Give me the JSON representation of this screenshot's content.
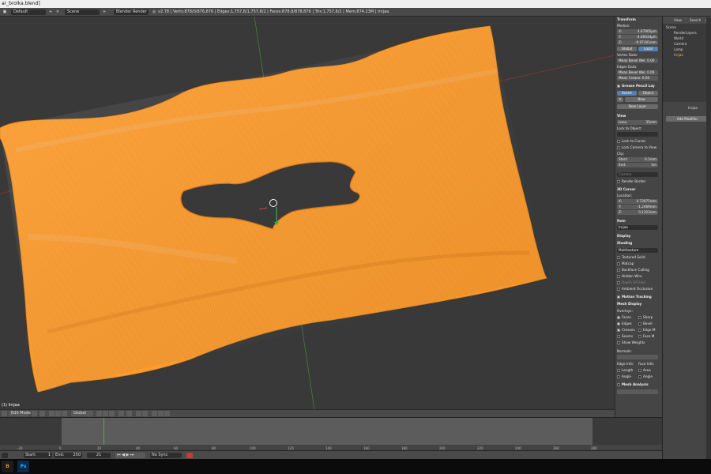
{
  "window": {
    "title": "ar_brolka.blend]"
  },
  "topbar": {
    "layout": "Default",
    "scene": "Scene",
    "render_engine": "Blender Render",
    "stats": "v2.78 | Verts:878/0/876,876 | Edges:1,757,8/1,757,8/2 | Faces:878,8/878,876 | Tris:1,757,8/2 | Mem:874.23M | Irnjaa"
  },
  "viewport": {
    "object_label": "(1) Irnjaa",
    "mesh_color": "#ff9d2e",
    "background": "#393939"
  },
  "viewport_header": {
    "mode": "Edit Mode",
    "pivot": "Global"
  },
  "timeline": {
    "start_label": "Start:",
    "start_value": "1",
    "end_label": "End:",
    "end_value": "250",
    "current_frame": "21",
    "sync": "No Sync",
    "ticks": [
      "-20",
      "0",
      "20",
      "40",
      "60",
      "80",
      "100",
      "120",
      "140",
      "160",
      "180",
      "200",
      "220",
      "240",
      "260",
      "280"
    ]
  },
  "properties": {
    "transform": "Transform",
    "median": "Median:",
    "x_label": "X:",
    "x_value": "4.67905μm",
    "y_label": "Y:",
    "y_value": "-4.60034μm",
    "z_label": "Z:",
    "z_value": "-0.97301mm",
    "global": "Global",
    "local": "Local",
    "vertex_data": "Vertex Data:",
    "mean_bevel_weight": "Mean Bevel Wei: 0.00",
    "edges_data": "Edges Data:",
    "mean_bevel_weight2": "Mean Bevel Wei: 0.00",
    "mean_crease": "Mean Crease: 0.00",
    "grease_pencil": "Grease Pencil Lay",
    "scene": "Scene",
    "object": "Object",
    "new": "New",
    "new_layer": "New Layer",
    "view": "View",
    "lens_label": "Lens:",
    "lens_value": "35mm",
    "lock_to_object": "Lock to Object:",
    "lock_to_cursor": "Lock to Cursor",
    "lock_camera": "Lock Camera to View",
    "clip": "Clip:",
    "clip_start_label": "Start:",
    "clip_start_value": "0.1mm",
    "clip_end_label": "End:",
    "clip_end_value": "1m",
    "local_camera": "Camera",
    "render_border": "Render Border",
    "cursor": "3D Cursor",
    "location": "Location:",
    "cx_label": "X:",
    "cx_value": "4.73075mm",
    "cy_label": "Y:",
    "cy_value": "-1.2469mm",
    "cz_label": "Z:",
    "cz_value": "0.1323mm",
    "item": "Item",
    "item_name": "Irnjaa",
    "display": "Display",
    "shading": "Shading",
    "shading_mode": "Multitexture",
    "textured_solid": "Textured Solid",
    "matcap": "Matcap",
    "backface": "Backface Culling",
    "hidden_wire": "Hidden Wire",
    "dof": "Depth Of Field",
    "ambient_occlusion": "Ambient Occlusion",
    "motion_tracking": "Motion Tracking",
    "mesh_display": "Mesh Display",
    "overlays": "Overlays:",
    "faces": "Faces",
    "sharp": "Sharp",
    "edges": "Edges",
    "bevel": "Bevel",
    "creases": "Creases",
    "edge_m": "Edge M",
    "seams": "Seams",
    "face_m": "Face M",
    "show_weights": "Show Weights",
    "normals": "Normals:",
    "edge_info": "Edge Info:",
    "face_info": "Face Info:",
    "length": "Length",
    "area": "Area",
    "angle": "Angle",
    "angle2": "Angle",
    "mesh_analysis": "Mesh Analysis"
  },
  "outliner": {
    "view": "View",
    "search": "Search",
    "all": "All",
    "items": [
      "Scene",
      "RenderLayers",
      "World",
      "Camera",
      "Lamp",
      "Irnjaa"
    ]
  },
  "modifiers": {
    "object_name": "Irnjaa",
    "add_modifier": "Add Modifier"
  },
  "taskbar": {
    "blender": "B",
    "photoshop": "Ps"
  }
}
